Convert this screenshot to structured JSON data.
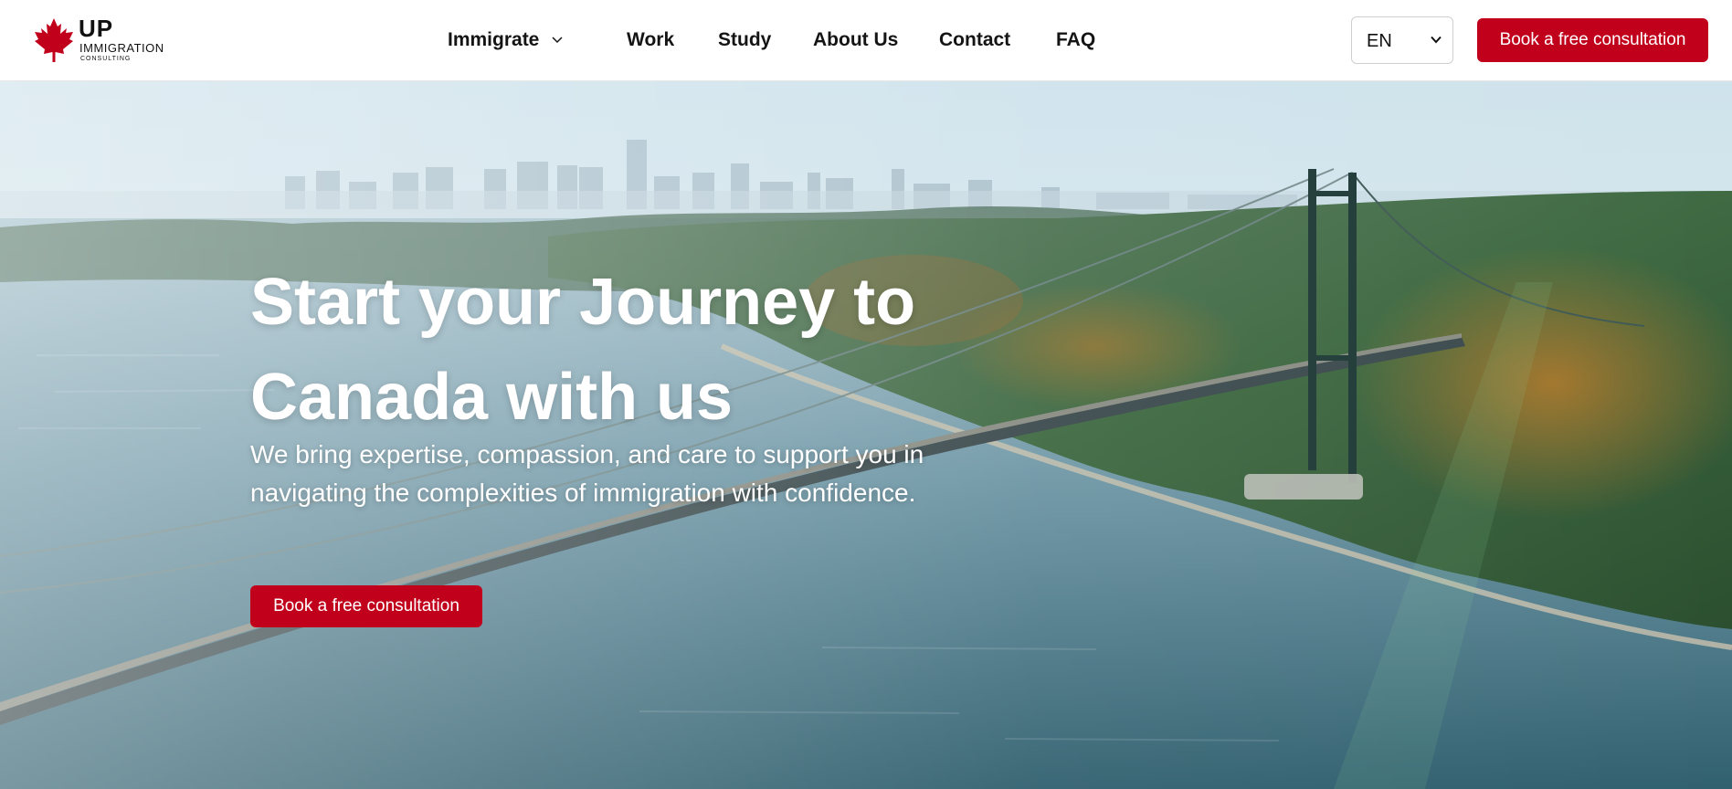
{
  "brand": {
    "logo_main": "UP",
    "logo_line1": "IMMIGRATION",
    "logo_line2": "CONSULTING",
    "colors": {
      "accent": "#c1001c",
      "leaf": "#c1001c",
      "text": "#141414"
    }
  },
  "nav": {
    "items": [
      {
        "label": "Immigrate",
        "has_dropdown": true,
        "icon": "chevron-down-icon"
      },
      {
        "label": "Work"
      },
      {
        "label": "Study"
      },
      {
        "label": "About Us"
      },
      {
        "label": "Contact"
      },
      {
        "label": "FAQ"
      }
    ]
  },
  "language": {
    "selected": "EN",
    "icon": "chevron-down-icon"
  },
  "header_cta": {
    "label": "Book a free consultation"
  },
  "hero": {
    "title": "Start your Journey to Canada with us",
    "subtitle": "We bring expertise, compassion, and care to support you in navigating the complexities of immigration with confidence.",
    "cta_label": "Book a free consultation"
  }
}
